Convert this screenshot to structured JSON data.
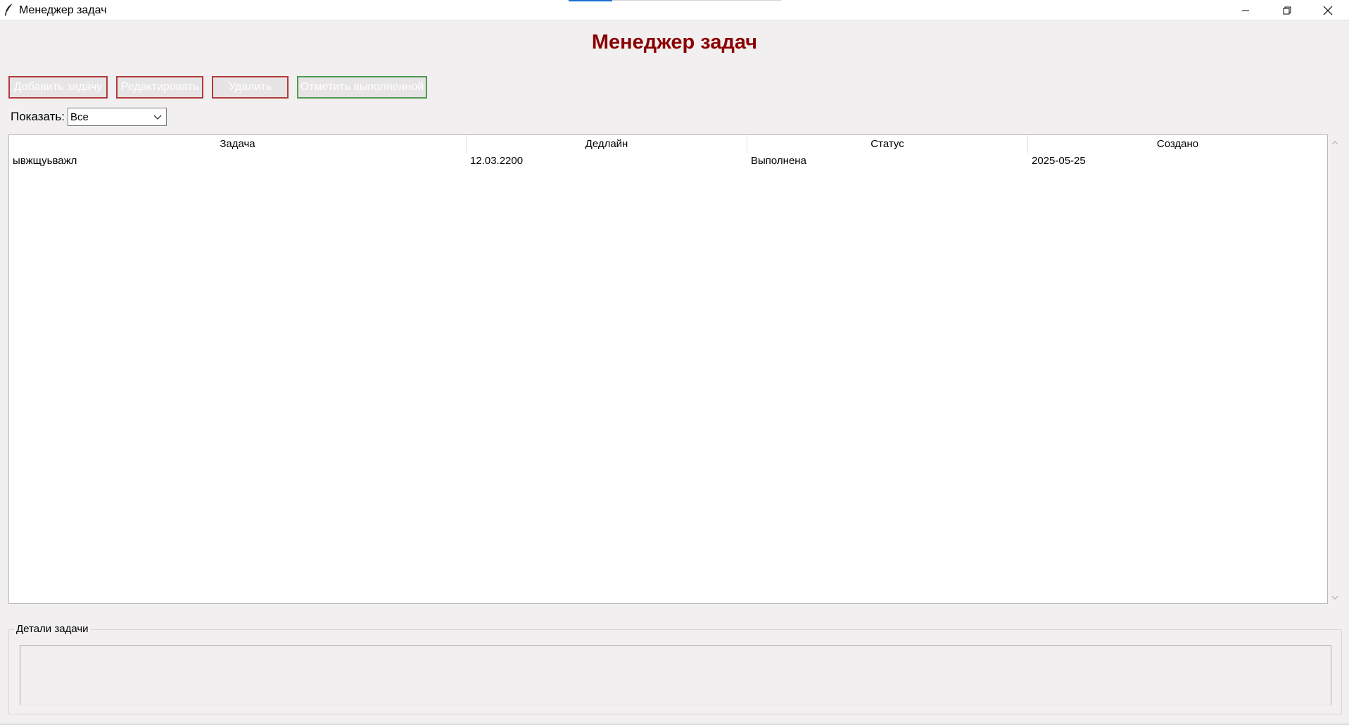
{
  "window": {
    "title": "Менеджер задач",
    "icon": "feather-icon",
    "controls": [
      "minimize-icon",
      "restore-icon",
      "close-icon"
    ]
  },
  "heading": "Менеджер задач",
  "toolbar": {
    "add_label": "Добавить задачу",
    "edit_label": "Редактировать",
    "delete_label": "Удалить",
    "complete_label": "Отметить выполненной"
  },
  "filter": {
    "label": "Показать:",
    "selected": "Все"
  },
  "table": {
    "columns": [
      "Задача",
      "Дедлайн",
      "Статус",
      "Создано"
    ],
    "rows": [
      [
        "ывжщуьважл",
        "12.03.2200",
        "Выполнена",
        "2025-05-25"
      ]
    ]
  },
  "details": {
    "label": "Детали задачи",
    "text": ""
  },
  "colors": {
    "heading": "#8b0000",
    "button_border_red": "#b23a3a",
    "button_border_green": "#4f9a4f",
    "background": "#f1efef"
  }
}
